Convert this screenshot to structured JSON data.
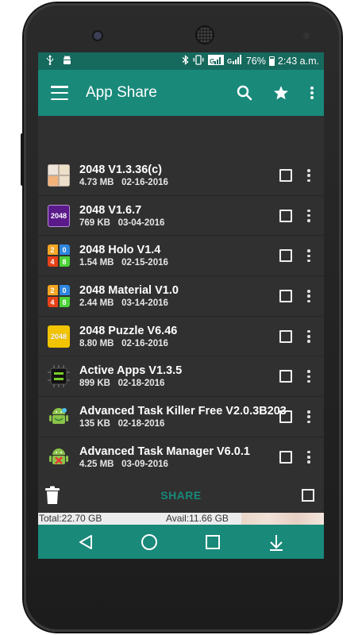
{
  "status_bar": {
    "battery": "76%",
    "time": "2:43 a.m."
  },
  "app_bar": {
    "title": "App Share",
    "icons": [
      "menu-icon",
      "search-icon",
      "star-icon",
      "more-vert-icon"
    ]
  },
  "apps": [
    {
      "name": "2048 V1.3.36(c)",
      "size": "4.73 MB",
      "date": "02-16-2016",
      "icon": "2048-tile-icon",
      "icon_color": "#c9b99e"
    },
    {
      "name": "2048 V1.6.7",
      "size": "769 KB",
      "date": "03-04-2016",
      "icon": "2048-purple-icon",
      "icon_color": "#5a1a8a",
      "icon_text": "2048"
    },
    {
      "name": "2048 Holo V1.4",
      "size": "1.54 MB",
      "date": "02-15-2016",
      "icon": "2048-holo-grid-icon"
    },
    {
      "name": "2048 Material V1.0",
      "size": "2.44 MB",
      "date": "03-14-2016",
      "icon": "2048-material-grid-icon"
    },
    {
      "name": "2048 Puzzle V6.46",
      "size": "8.80 MB",
      "date": "02-16-2016",
      "icon": "2048-puzzle-icon",
      "icon_color": "#f2c400",
      "icon_text": "2048"
    },
    {
      "name": "Active Apps V1.3.5",
      "size": "899 KB",
      "date": "02-18-2016",
      "icon": "active-apps-chip-icon"
    },
    {
      "name": "Advanced Task Killer Free V2.0.3B203",
      "size": "135 KB",
      "date": "02-18-2016",
      "icon": "android-robot-icon"
    },
    {
      "name": "Advanced Task Manager V6.0.1",
      "size": "4.25 MB",
      "date": "03-09-2016",
      "icon": "android-robot-x-icon"
    }
  ],
  "bottom_bar": {
    "share_label": "SHARE"
  },
  "storage": {
    "total": "Total:22.70 GB",
    "avail": "Avail:11.66 GB"
  },
  "colors": {
    "primary": "#19897a",
    "primary_dark": "#16695d",
    "background": "#303030"
  }
}
